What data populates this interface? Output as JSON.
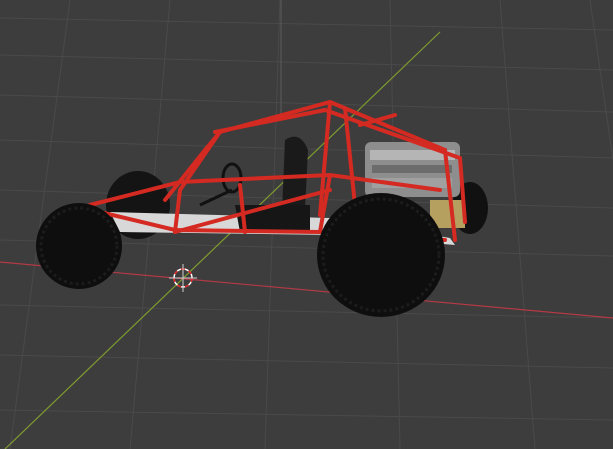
{
  "viewport": {
    "background": "#3d3d3d",
    "grid_color": "#4a4a4a",
    "x_axis_color": "#b33a45",
    "y_axis_color": "#7f9c2e",
    "z_axis_color": "#5a5a5a"
  },
  "model": {
    "frame_color": "#d42a22",
    "tire_color": "#111111",
    "engine_color": "#9a9a9a",
    "seat_color": "#1a1a1a",
    "floor_color": "#d8d8d8"
  },
  "cursor": {
    "outer_color": "#ffffff",
    "dash_color": "#e02020"
  }
}
